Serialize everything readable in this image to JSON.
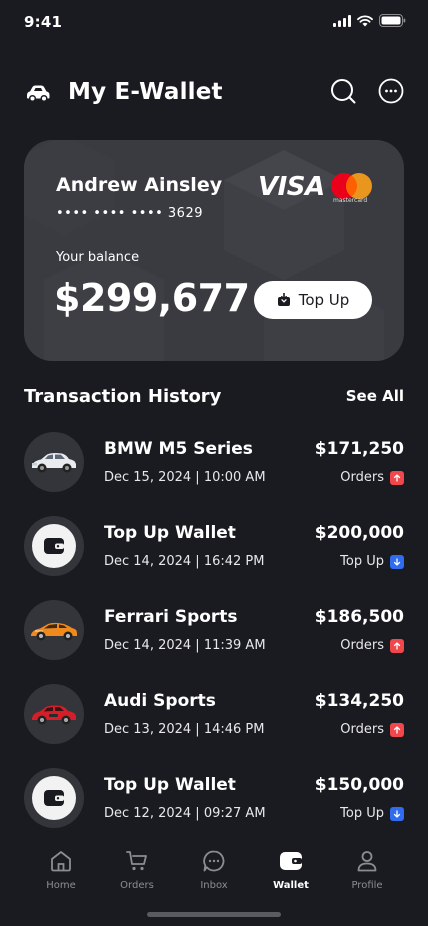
{
  "status": {
    "time": "9:41"
  },
  "header": {
    "title": "My E-Wallet",
    "logo_icon": "car-icon",
    "search_icon": "search-icon",
    "more_icon": "more-icon"
  },
  "card": {
    "holder": "Andrew Ainsley",
    "number": "•••• •••• •••• 3629",
    "brand_visa": "VISA",
    "brand_mc_label": "mastercard",
    "balance_label": "Your balance",
    "balance": "$299,677",
    "topup_label": "Top Up",
    "colors": {
      "mc_red": "#eb001b",
      "mc_orange": "#f79e1b"
    }
  },
  "transactions": {
    "title": "Transaction History",
    "see_all": "See All",
    "items": [
      {
        "name": "BMW M5 Series",
        "date": "Dec 15, 2024 | 10:00 AM",
        "amount": "$171,250",
        "type": "Orders",
        "direction": "out",
        "avatar": "car-white"
      },
      {
        "name": "Top Up Wallet",
        "date": "Dec 14, 2024 | 16:42 PM",
        "amount": "$200,000",
        "type": "Top Up",
        "direction": "in",
        "avatar": "wallet"
      },
      {
        "name": "Ferrari Sports",
        "date": "Dec 14, 2024 | 11:39 AM",
        "amount": "$186,500",
        "type": "Orders",
        "direction": "out",
        "avatar": "car-orange"
      },
      {
        "name": "Audi Sports",
        "date": "Dec 13, 2024 | 14:46 PM",
        "amount": "$134,250",
        "type": "Orders",
        "direction": "out",
        "avatar": "car-red"
      },
      {
        "name": "Top Up Wallet",
        "date": "Dec 12, 2024 | 09:27 AM",
        "amount": "$150,000",
        "type": "Top Up",
        "direction": "in",
        "avatar": "wallet"
      }
    ]
  },
  "tabs": [
    {
      "label": "Home",
      "icon": "home-icon",
      "active": false
    },
    {
      "label": "Orders",
      "icon": "cart-icon",
      "active": false
    },
    {
      "label": "Inbox",
      "icon": "chat-icon",
      "active": false
    },
    {
      "label": "Wallet",
      "icon": "wallet-icon",
      "active": true
    },
    {
      "label": "Profile",
      "icon": "profile-icon",
      "active": false
    }
  ]
}
